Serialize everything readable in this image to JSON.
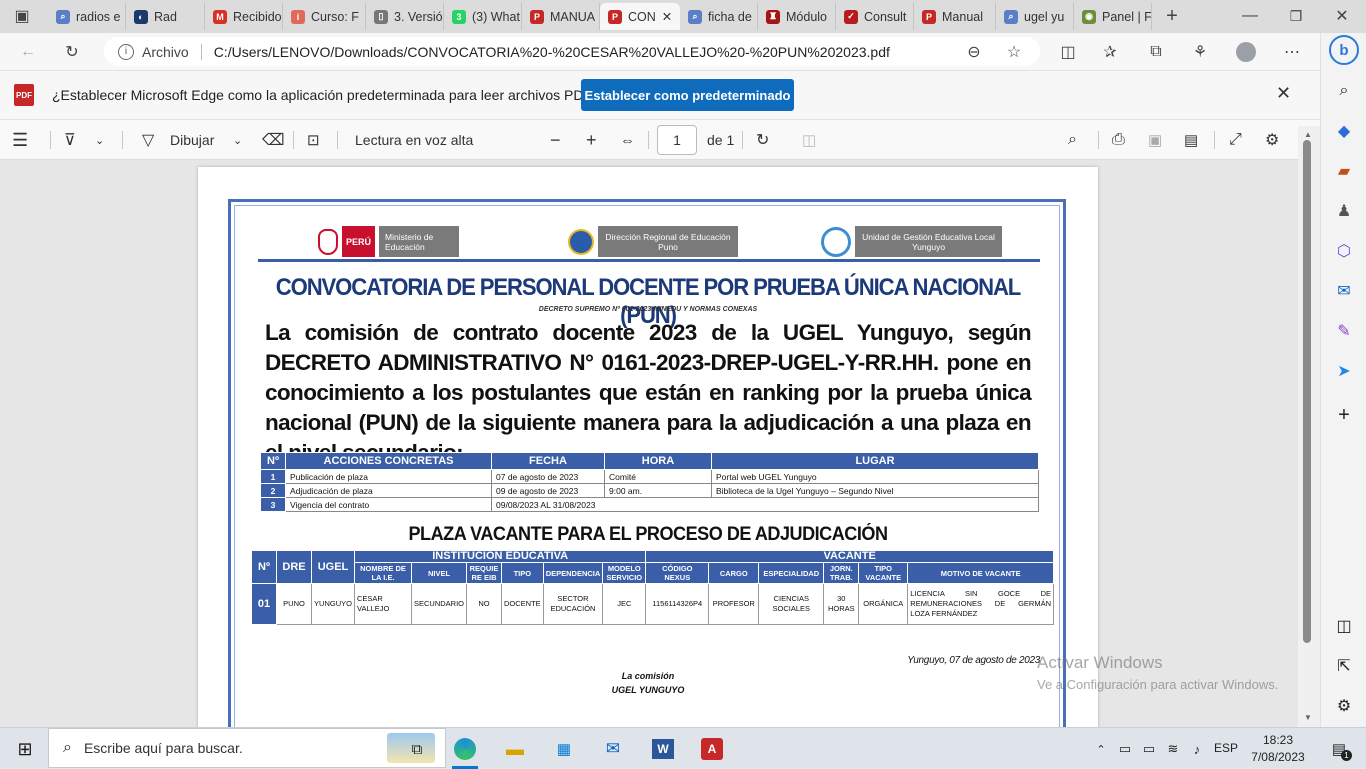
{
  "tabs": [
    {
      "label": "radios e",
      "icon": "search-icon",
      "color": "#5b7fc7"
    },
    {
      "label": "Rad",
      "icon": "speaker-icon",
      "color": "#1b3a6b"
    },
    {
      "label": "Recibido",
      "icon": "gmail-icon",
      "color": "#d93025"
    },
    {
      "label": "Curso: F",
      "icon": "ipeg-icon",
      "color": "#e06a5a"
    },
    {
      "label": "3. Versió",
      "icon": "document-icon",
      "color": "#777777"
    },
    {
      "label": "(3) What",
      "icon": "whatsapp-icon",
      "color": "#25d366"
    },
    {
      "label": "MANUA",
      "icon": "pdf-icon",
      "color": "#c62828"
    },
    {
      "label": "CON",
      "icon": "pdf-icon",
      "color": "#c62828"
    },
    {
      "label": "ficha de",
      "icon": "search-icon",
      "color": "#5b7fc7"
    },
    {
      "label": "Módulo",
      "icon": "crest-icon",
      "color": "#a31515"
    },
    {
      "label": "Consult",
      "icon": "check-icon",
      "color": "#b71c1c"
    },
    {
      "label": "Manual",
      "icon": "pdf-icon",
      "color": "#c62828"
    },
    {
      "label": "ugel yu",
      "icon": "search-icon",
      "color": "#5b7fc7"
    },
    {
      "label": "Panel | F",
      "icon": "panel-icon",
      "color": "#6b8e3a"
    }
  ],
  "address": {
    "site_label": "Archivo",
    "url": "C:/Users/LENOVO/Downloads/CONVOCATORIA%20-%20CESAR%20VALLEJO%20-%20PUN%202023.pdf"
  },
  "infobar": {
    "message": "¿Establecer Microsoft Edge como la aplicación predeterminada para leer archivos PDF?",
    "button": "Establecer como predeterminado",
    "pdf_badge": "PDF"
  },
  "pdf_toolbar": {
    "draw_label": "Dibujar",
    "read_aloud": "Lectura en voz alta",
    "page_number": "1",
    "page_of": "de 1"
  },
  "doc": {
    "logo1_brand": "PERÚ",
    "logo1_text": "Ministerio de Educación",
    "logo2_text": "Dirección Regional de Educación Puno",
    "logo3_text": "Unidad de Gestión Educativa Local Yunguyo",
    "title": "CONVOCATORIA DE PERSONAL DOCENTE POR PRUEBA ÚNICA NACIONAL (PUN)",
    "subtitle": "DECRETO SUPREMO Nº 001-2023-MINEDU Y NORMAS CONEXAS",
    "body": "La comisión de contrato docente 2023 de la UGEL Yunguyo, según DECRETO ADMINISTRATIVO N° 0161-2023-DREP-UGEL-Y-RR.HH. pone en conocimiento a los postulantes que están en ranking por la prueba única nacional (PUN) de la siguiente manera para la adjudicación a una plaza en el nivel secundario:",
    "schedule": {
      "headers": [
        "Nº",
        "ACCIONES CONCRETAS",
        "FECHA",
        "HORA",
        "LUGAR"
      ],
      "rows": [
        [
          "1",
          "Publicación de plaza",
          "07 de agosto de 2023",
          "Comité",
          "Portal web UGEL Yunguyo"
        ],
        [
          "2",
          "Adjudicación de plaza",
          "09 de agosto de 2023",
          "9:00 am.",
          "Biblioteca de la Ugel Yunguyo – Segundo Nivel"
        ],
        [
          "3",
          "Vigencia del contrato",
          "09/08/2023 AL 31/08/2023",
          "",
          ""
        ]
      ]
    },
    "section_title": "PLAZA VACANTE PARA EL PROCESO DE ADJUDICACIÓN",
    "vacancy": {
      "h_n": "Nº",
      "h_dre": "DRE",
      "h_ugel": "UGEL",
      "h_inst": "INSTITUCIÓN EDUCATIVA",
      "h_vac": "VACANTE",
      "sub": [
        "NOMBRE DE LA I.E.",
        "NIVEL",
        "REQUIE RE EIB",
        "TIPO",
        "DEPENDENCIA",
        "MODELO SERVICIO",
        "CÓDIGO NEXUS",
        "CARGO",
        "ESPECIALIDAD",
        "JORN. TRAB.",
        "TIPO VACANTE",
        "MOTIVO DE VACANTE"
      ],
      "row": [
        "01",
        "PUNO",
        "YUNGUYO",
        "CESAR VALLEJO",
        "SECUNDARIO",
        "NO",
        "DOCENTE",
        "SECTOR EDUCACIÓN",
        "JEC",
        "1156114326P4",
        "PROFESOR",
        "CIENCIAS SOCIALES",
        "30 HORAS",
        "ORGÁNICA",
        "LICENCIA SIN GOCE DE REMUNERACIONES DE GERMÁN LOZA FERNÁNDEZ"
      ]
    },
    "date_place": "Yunguyo, 07 de agosto de 2023",
    "signature1": "La comisión",
    "signature2": "UGEL YUNGUYO"
  },
  "watermark": {
    "line1": "Activar Windows",
    "line2": "Ve a Configuración para activar Windows."
  },
  "taskbar": {
    "search_placeholder": "Escribe aquí para buscar.",
    "lang": "ESP",
    "time": "18:23",
    "date": "7/08/2023",
    "notif_count": "1"
  }
}
